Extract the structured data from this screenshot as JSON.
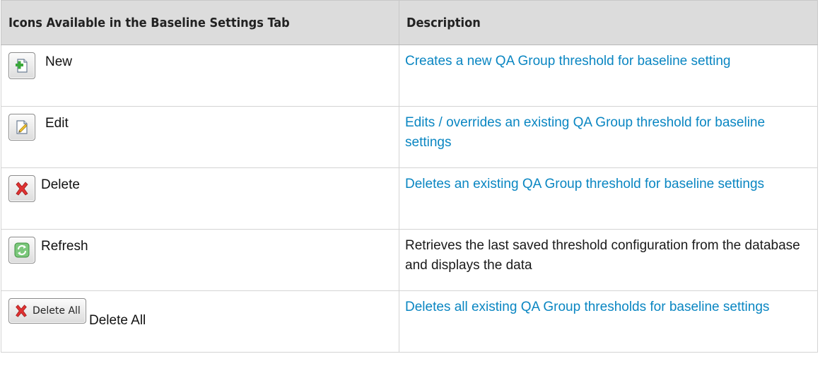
{
  "table": {
    "headers": [
      "Icons Available in the Baseline Settings Tab",
      "Description"
    ],
    "rows": [
      {
        "label": "New",
        "icon": "new-icon",
        "description": "Creates a new QA Group threshold for baseline setting",
        "linked": true
      },
      {
        "label": "Edit",
        "icon": "edit-icon",
        "description": "Edits / overrides an existing QA Group threshold for baseline settings",
        "linked": true
      },
      {
        "label": "Delete",
        "icon": "delete-icon",
        "description": "Deletes an existing QA Group threshold for baseline settings",
        "linked": true
      },
      {
        "label": "Refresh",
        "icon": "refresh-icon",
        "description": "Retrieves the last saved threshold configuration from the database and displays the data",
        "linked": false
      },
      {
        "label": "Delete All",
        "icon": "delete-all-icon",
        "button_text": "Delete All",
        "description": "Deletes all existing QA Group thresholds for baseline settings",
        "linked": true
      }
    ]
  },
  "colors": {
    "link": "#0a86c2",
    "header_bg": "#dcdcdc",
    "text": "#1a1a1a"
  }
}
